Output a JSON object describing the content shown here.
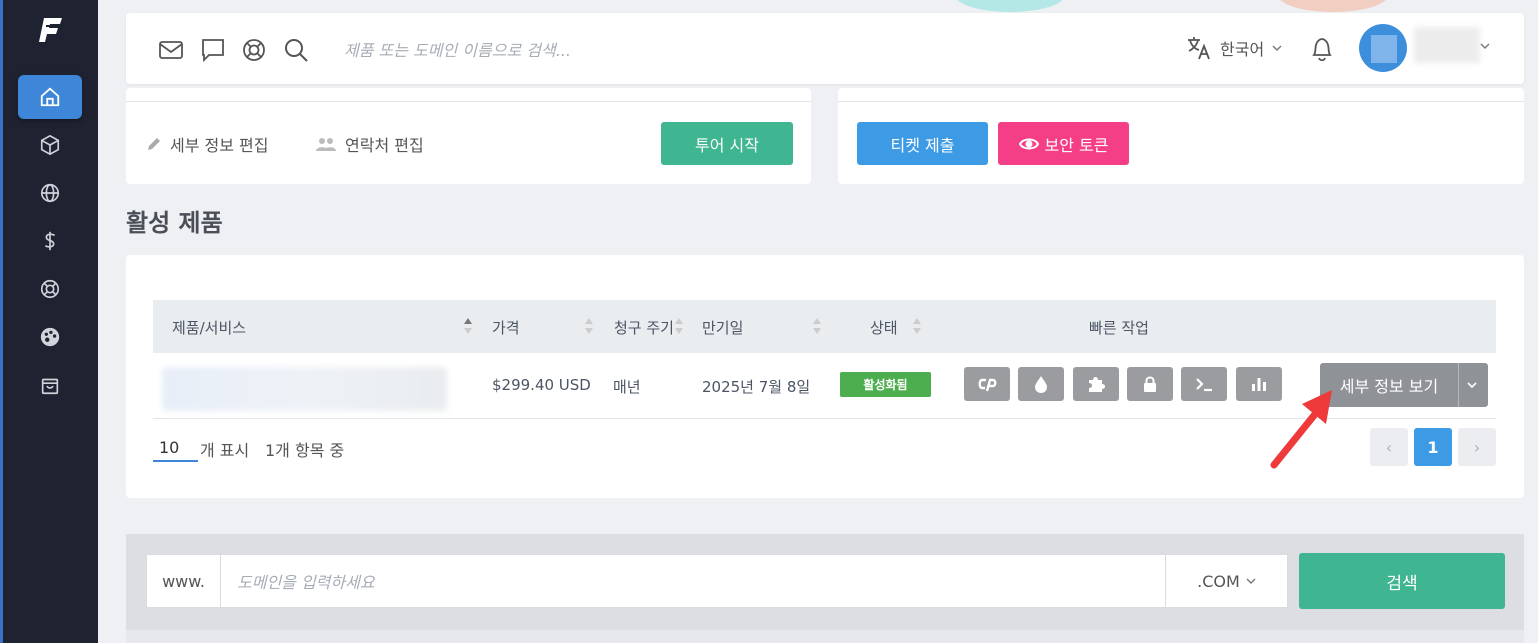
{
  "header": {
    "search_placeholder": "제품 또는 도메인 이름으로 검색...",
    "language": "한국어",
    "icons": [
      "mail-icon",
      "chat-icon",
      "lifebuoy-icon",
      "search-icon",
      "translate-icon",
      "bell-icon"
    ]
  },
  "sidebar": {
    "items": [
      {
        "icon": "home-icon",
        "active": true
      },
      {
        "icon": "box-icon",
        "active": false
      },
      {
        "icon": "globe-icon",
        "active": false
      },
      {
        "icon": "dollar-icon",
        "active": false
      },
      {
        "icon": "lifebuoy-icon",
        "active": false
      },
      {
        "icon": "palette-icon",
        "active": false
      },
      {
        "icon": "shopping-bag-icon",
        "active": false
      }
    ]
  },
  "actions": {
    "edit_details": "세부 정보 편집",
    "edit_contacts": "연락처 편집",
    "start_tour": "투어 시작",
    "submit_ticket": "티켓 제출",
    "security_token": "보안 토큰"
  },
  "products": {
    "title": "활성 제품",
    "columns": [
      "제품/서비스",
      "가격",
      "청구 주기",
      "만기일",
      "상태",
      "빠른 작업"
    ],
    "rows": [
      {
        "price": "$299.40 USD",
        "cycle": "매년",
        "due": "2025년 7월 8일",
        "status": "활성화됨",
        "quick_actions": [
          "cpanel-icon",
          "drop-icon",
          "puzzle-icon",
          "lock-icon",
          "terminal-icon",
          "chart-icon"
        ],
        "details_label": "세부 정보 보기"
      }
    ],
    "page_size": "10",
    "page_size_label": "개 표시",
    "count_label": "1개 항목 중",
    "pagination": {
      "prev": "‹",
      "current": "1",
      "next": "›"
    }
  },
  "domain_search": {
    "prefix": "www.",
    "placeholder": "도메인을 입력하세요",
    "tld": ".COM",
    "button": "검색"
  },
  "colors": {
    "sidebar_bg": "#1f2331",
    "accent_blue": "#3d86d8",
    "green": "#3fb592",
    "pink": "#f43f86",
    "status_green": "#4cae4f"
  }
}
